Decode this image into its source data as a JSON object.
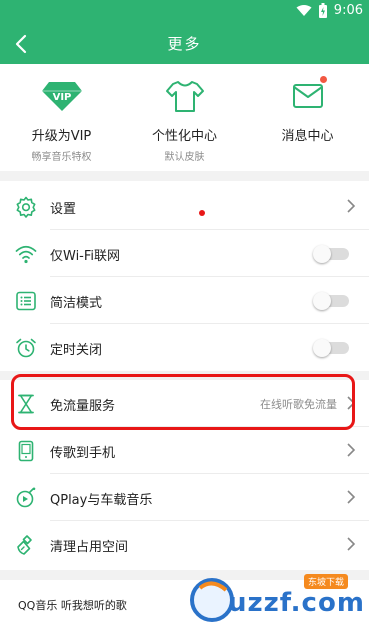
{
  "status_bar": {
    "time": "9:06"
  },
  "header": {
    "title": "更多"
  },
  "features": [
    {
      "title": "升级为VIP",
      "subtitle": "畅享音乐特权",
      "icon": "vip-diamond-icon",
      "badge": "VIP"
    },
    {
      "title": "个性化中心",
      "subtitle": "默认皮肤",
      "icon": "tshirt-icon"
    },
    {
      "title": "消息中心",
      "subtitle": "",
      "icon": "envelope-icon",
      "has_dot": true
    }
  ],
  "settings": {
    "items": [
      {
        "label": "设置",
        "icon": "gear-icon",
        "type": "chevron"
      },
      {
        "label": "仅Wi-Fi联网",
        "icon": "wifi-icon",
        "type": "toggle",
        "on": false
      },
      {
        "label": "简洁模式",
        "icon": "list-icon",
        "type": "toggle",
        "on": false
      },
      {
        "label": "定时关闭",
        "icon": "alarm-clock-icon",
        "type": "toggle",
        "on": false
      }
    ]
  },
  "services": {
    "items": [
      {
        "label": "免流量服务",
        "hint": "在线听歌免流量",
        "icon": "hourglass-icon",
        "type": "chevron"
      },
      {
        "label": "传歌到手机",
        "icon": "phone-icon",
        "type": "chevron"
      },
      {
        "label": "QPlay与车载音乐",
        "icon": "qplay-icon",
        "type": "chevron"
      },
      {
        "label": "清理占用空间",
        "icon": "broom-icon",
        "type": "chevron"
      }
    ]
  },
  "footer": {
    "text": "QQ音乐 听我想听的歌"
  },
  "watermark": {
    "text": "uzzf.com",
    "badge": "东坡下载"
  },
  "colors": {
    "brand_green": "#2eb372",
    "highlight_red": "#e81717",
    "dot_orange": "#f25842"
  }
}
